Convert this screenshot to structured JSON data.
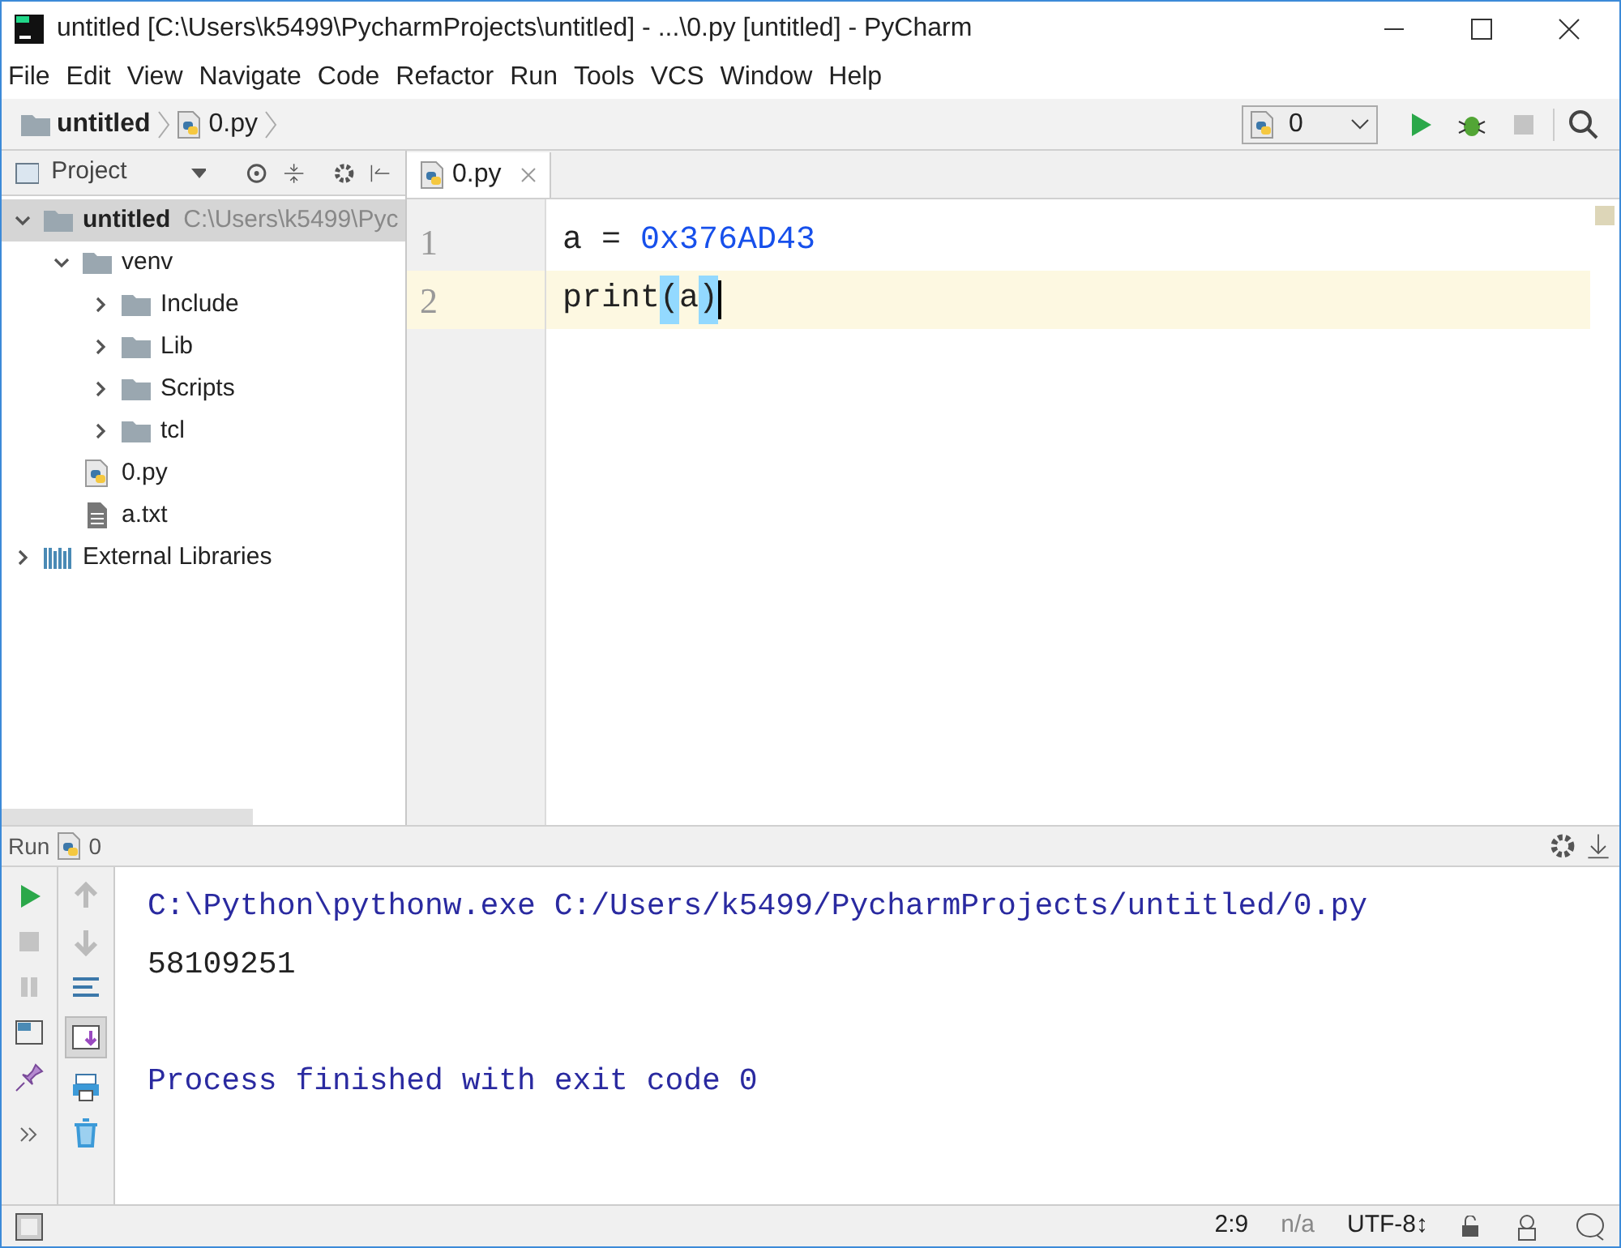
{
  "window": {
    "title": "untitled [C:\\Users\\k5499\\PycharmProjects\\untitled] - ...\\0.py [untitled] - PyCharm"
  },
  "menu": [
    "File",
    "Edit",
    "View",
    "Navigate",
    "Code",
    "Refactor",
    "Run",
    "Tools",
    "VCS",
    "Window",
    "Help"
  ],
  "breadcrumbs": [
    {
      "label": "untitled",
      "kind": "folder"
    },
    {
      "label": "0.py",
      "kind": "python"
    }
  ],
  "run_config": {
    "value": "0"
  },
  "project_panel": {
    "title": "Project",
    "tree": [
      {
        "label": "untitled",
        "path": "C:\\Users\\k5499\\Pyc",
        "kind": "folder",
        "expanded": true,
        "selected": true,
        "children": [
          {
            "label": "venv",
            "kind": "folder",
            "expanded": true,
            "selected": false,
            "children": [
              {
                "label": "Include",
                "kind": "folder",
                "expanded": false,
                "selected": false
              },
              {
                "label": "Lib",
                "kind": "folder",
                "expanded": false,
                "selected": false
              },
              {
                "label": "Scripts",
                "kind": "folder",
                "expanded": false,
                "selected": false
              },
              {
                "label": "tcl",
                "kind": "folder",
                "expanded": false,
                "selected": false
              }
            ]
          },
          {
            "label": "0.py",
            "kind": "python",
            "selected": false
          },
          {
            "label": "a.txt",
            "kind": "text",
            "selected": false
          }
        ]
      },
      {
        "label": "External Libraries",
        "kind": "library",
        "expanded": false,
        "selected": false
      }
    ]
  },
  "editor": {
    "tabs": [
      {
        "label": "0.py",
        "selected": true
      }
    ],
    "lines": [
      {
        "number": "1",
        "selected": false,
        "tokens": [
          {
            "text": "a = ",
            "kind": "plain"
          },
          {
            "text": "0x376AD43",
            "kind": "number"
          }
        ]
      },
      {
        "number": "2",
        "selected": true,
        "tokens": [
          {
            "text": "print",
            "kind": "plain"
          },
          {
            "text": "(",
            "kind": "brace"
          },
          {
            "text": "a",
            "kind": "plain"
          },
          {
            "text": ")",
            "kind": "brace"
          }
        ]
      }
    ]
  },
  "run_panel": {
    "title": "Run",
    "config": "0",
    "console": [
      {
        "text": "C:\\Python\\pythonw.exe C:/Users/k5499/PycharmProjects/untitled/0.py",
        "kind": "system"
      },
      {
        "text": "58109251",
        "kind": "output"
      },
      {
        "kind": "blank"
      },
      {
        "text": "Process finished with exit code 0",
        "kind": "system"
      }
    ]
  },
  "status_bar": {
    "position": "2:9",
    "na": "n/a",
    "encoding": "UTF-8↕"
  }
}
